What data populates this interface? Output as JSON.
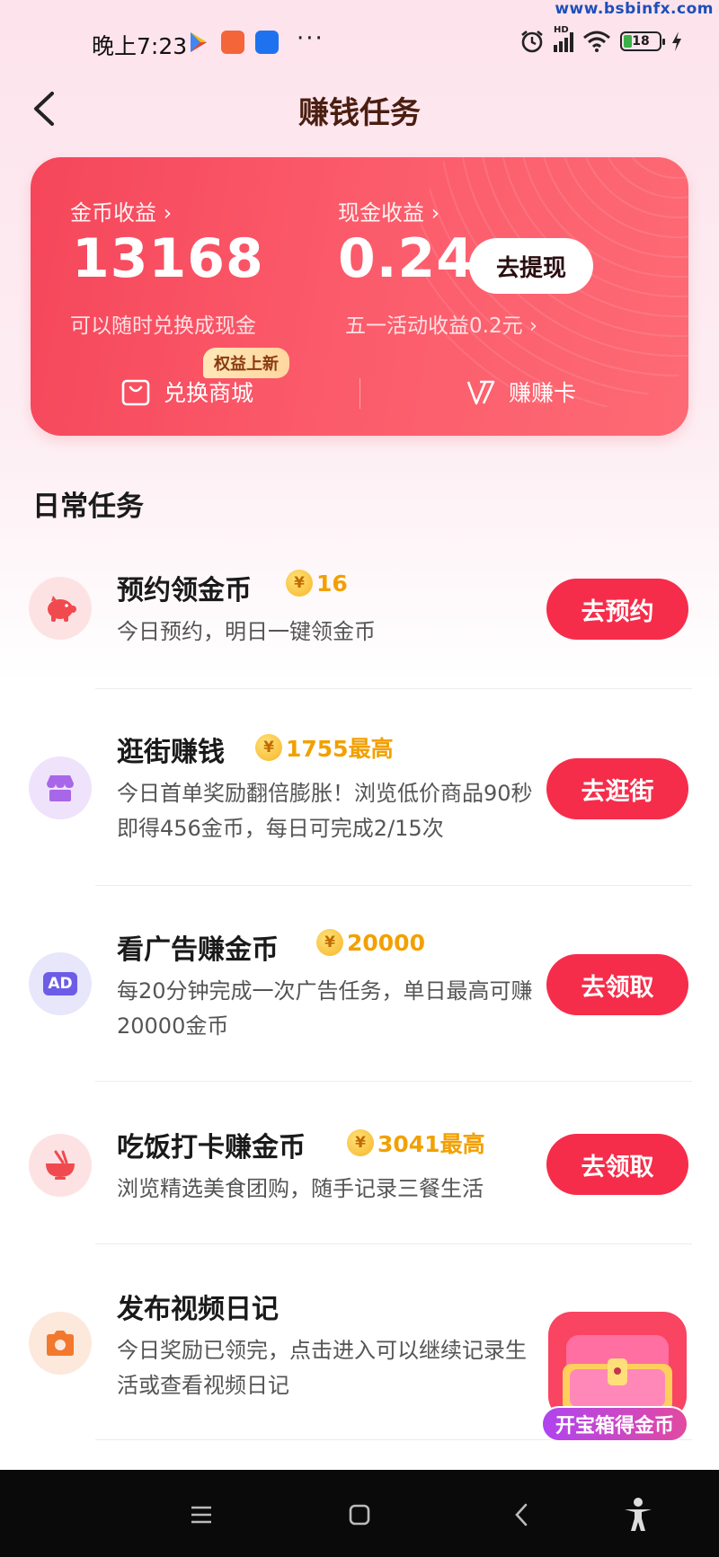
{
  "watermark": "www.bsbinfx.com",
  "status_bar": {
    "time": "晚上7:23",
    "more": "···",
    "battery": "18",
    "network": "HD"
  },
  "header": {
    "title": "赚钱任务"
  },
  "earnings": {
    "coin_label": "金币收益 ›",
    "coin_value": "13168",
    "coin_sub": "可以随时兑换成现金",
    "cash_label": "现金收益 ›",
    "cash_value": "0.24",
    "withdraw_label": "去提现",
    "cash_sub": "五一活动收益0.2元 ›",
    "new_badge": "权益上新",
    "mall_label": "兑换商城",
    "card_label": "赚赚卡"
  },
  "section_title": "日常任务",
  "tasks": [
    {
      "title": "预约领金币",
      "reward": "16",
      "desc": "今日预约，明日一键领金币",
      "button": "去预约",
      "icon": "piggy-bank-icon"
    },
    {
      "title": "逛街赚钱",
      "reward": "1755最高",
      "desc": "今日首单奖励翻倍膨胀！浏览低价商品90秒即得456金币，每日可完成2/15次",
      "button": "去逛街",
      "icon": "store-icon"
    },
    {
      "title": "看广告赚金币",
      "reward": "20000",
      "desc": "每20分钟完成一次广告任务，单日最高可赚20000金币",
      "button": "去领取",
      "icon": "ad-icon",
      "icon_text": "AD"
    },
    {
      "title": "吃饭打卡赚金币",
      "reward": "3041最高",
      "desc": "浏览精选美食团购，随手记录三餐生活",
      "button": "去领取",
      "icon": "bowl-icon"
    },
    {
      "title": "发布视频日记",
      "desc": "今日奖励已领完，点击进入可以继续记录生活或查看视频日记",
      "icon": "camera-icon"
    }
  ],
  "coin_symbol": "¥",
  "treasure": {
    "label": "开宝箱得金币"
  },
  "colors": {
    "accent": "#f52d4a",
    "reward": "#f2a000",
    "title": "#4a1e10"
  }
}
